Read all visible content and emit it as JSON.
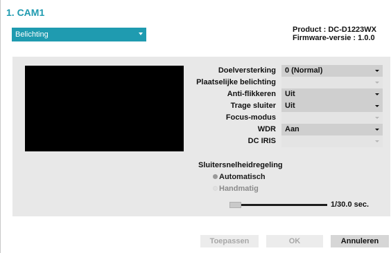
{
  "header": {
    "title": "1. CAM1"
  },
  "category_select": {
    "value": "Belichting"
  },
  "product_info": {
    "product": "Product : DC-D1223WX",
    "firmware": "Firmware-versie : 1.0.0"
  },
  "settings": [
    {
      "label": "Doelversterking",
      "value": "0 (Normal)",
      "enabled": true
    },
    {
      "label": "Plaatselijke belichting",
      "value": "",
      "enabled": false
    },
    {
      "label": "Anti-flikkeren",
      "value": "Uit",
      "enabled": true
    },
    {
      "label": "Trage sluiter",
      "value": "Uit",
      "enabled": true
    },
    {
      "label": "Focus-modus",
      "value": "",
      "enabled": false
    },
    {
      "label": "WDR",
      "value": "Aan",
      "enabled": true
    },
    {
      "label": "DC IRIS",
      "value": "",
      "enabled": false
    }
  ],
  "shutter": {
    "section_label": "Sluitersnelheidregeling",
    "options": [
      "Automatisch",
      "Handmatig"
    ],
    "selected": "Automatisch",
    "speed_label": "1/30.0 sec.",
    "slider_position": 0
  },
  "buttons": {
    "apply": "Toepassen",
    "ok": "OK",
    "cancel": "Annuleren"
  },
  "colors": {
    "accent": "#1f9bb0",
    "panel": "#e8e8e8"
  }
}
